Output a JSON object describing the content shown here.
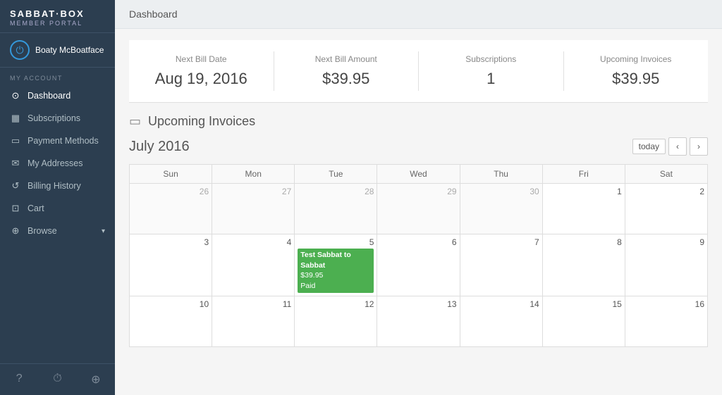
{
  "sidebar": {
    "logo": {
      "main": "SABBAT·BOX",
      "sub": "MEMBER PORTAL"
    },
    "user": {
      "name": "Boaty McBoatface"
    },
    "section_label": "MY ACCOUNT",
    "items": [
      {
        "id": "dashboard",
        "label": "Dashboard",
        "icon": "⊙",
        "active": true
      },
      {
        "id": "subscriptions",
        "label": "Subscriptions",
        "icon": "📅"
      },
      {
        "id": "payment-methods",
        "label": "Payment Methods",
        "icon": "💳"
      },
      {
        "id": "my-addresses",
        "label": "My Addresses",
        "icon": "✉"
      },
      {
        "id": "billing-history",
        "label": "Billing History",
        "icon": "🔄"
      },
      {
        "id": "cart",
        "label": "Cart",
        "icon": "🛒"
      },
      {
        "id": "browse",
        "label": "Browse",
        "icon": "⊕",
        "has_arrow": true
      }
    ],
    "footer": [
      {
        "id": "help",
        "icon": "?"
      },
      {
        "id": "clock",
        "icon": "⏱"
      },
      {
        "id": "sign-out",
        "icon": "⊕"
      }
    ]
  },
  "header": {
    "title": "Dashboard"
  },
  "stats": [
    {
      "id": "next-bill-date",
      "label": "Next Bill Date",
      "value": "Aug 19, 2016"
    },
    {
      "id": "next-bill-amount",
      "label": "Next Bill Amount",
      "value": "$39.95"
    },
    {
      "id": "subscriptions",
      "label": "Subscriptions",
      "value": "1"
    },
    {
      "id": "upcoming-invoices",
      "label": "Upcoming Invoices",
      "value": "$39.95"
    }
  ],
  "upcoming_invoices": {
    "section_title": "Upcoming Invoices"
  },
  "calendar": {
    "month_label": "July 2016",
    "today_label": "today",
    "days_of_week": [
      "Sun",
      "Mon",
      "Tue",
      "Wed",
      "Thu",
      "Fri",
      "Sat"
    ],
    "weeks": [
      [
        {
          "day": "26",
          "month": "other"
        },
        {
          "day": "27",
          "month": "other"
        },
        {
          "day": "28",
          "month": "other"
        },
        {
          "day": "29",
          "month": "other"
        },
        {
          "day": "30",
          "month": "other"
        },
        {
          "day": "1",
          "month": "current"
        },
        {
          "day": "2",
          "month": "current"
        }
      ],
      [
        {
          "day": "3",
          "month": "current"
        },
        {
          "day": "4",
          "month": "current"
        },
        {
          "day": "5",
          "month": "current",
          "event": {
            "title": "Test Sabbat to Sabbat",
            "amount": "$39.95",
            "status": "Paid"
          }
        },
        {
          "day": "6",
          "month": "current"
        },
        {
          "day": "7",
          "month": "current"
        },
        {
          "day": "8",
          "month": "current"
        },
        {
          "day": "9",
          "month": "current"
        }
      ],
      [
        {
          "day": "10",
          "month": "current"
        },
        {
          "day": "11",
          "month": "current"
        },
        {
          "day": "12",
          "month": "current"
        },
        {
          "day": "13",
          "month": "current"
        },
        {
          "day": "14",
          "month": "current"
        },
        {
          "day": "15",
          "month": "current"
        },
        {
          "day": "16",
          "month": "current"
        }
      ]
    ]
  }
}
